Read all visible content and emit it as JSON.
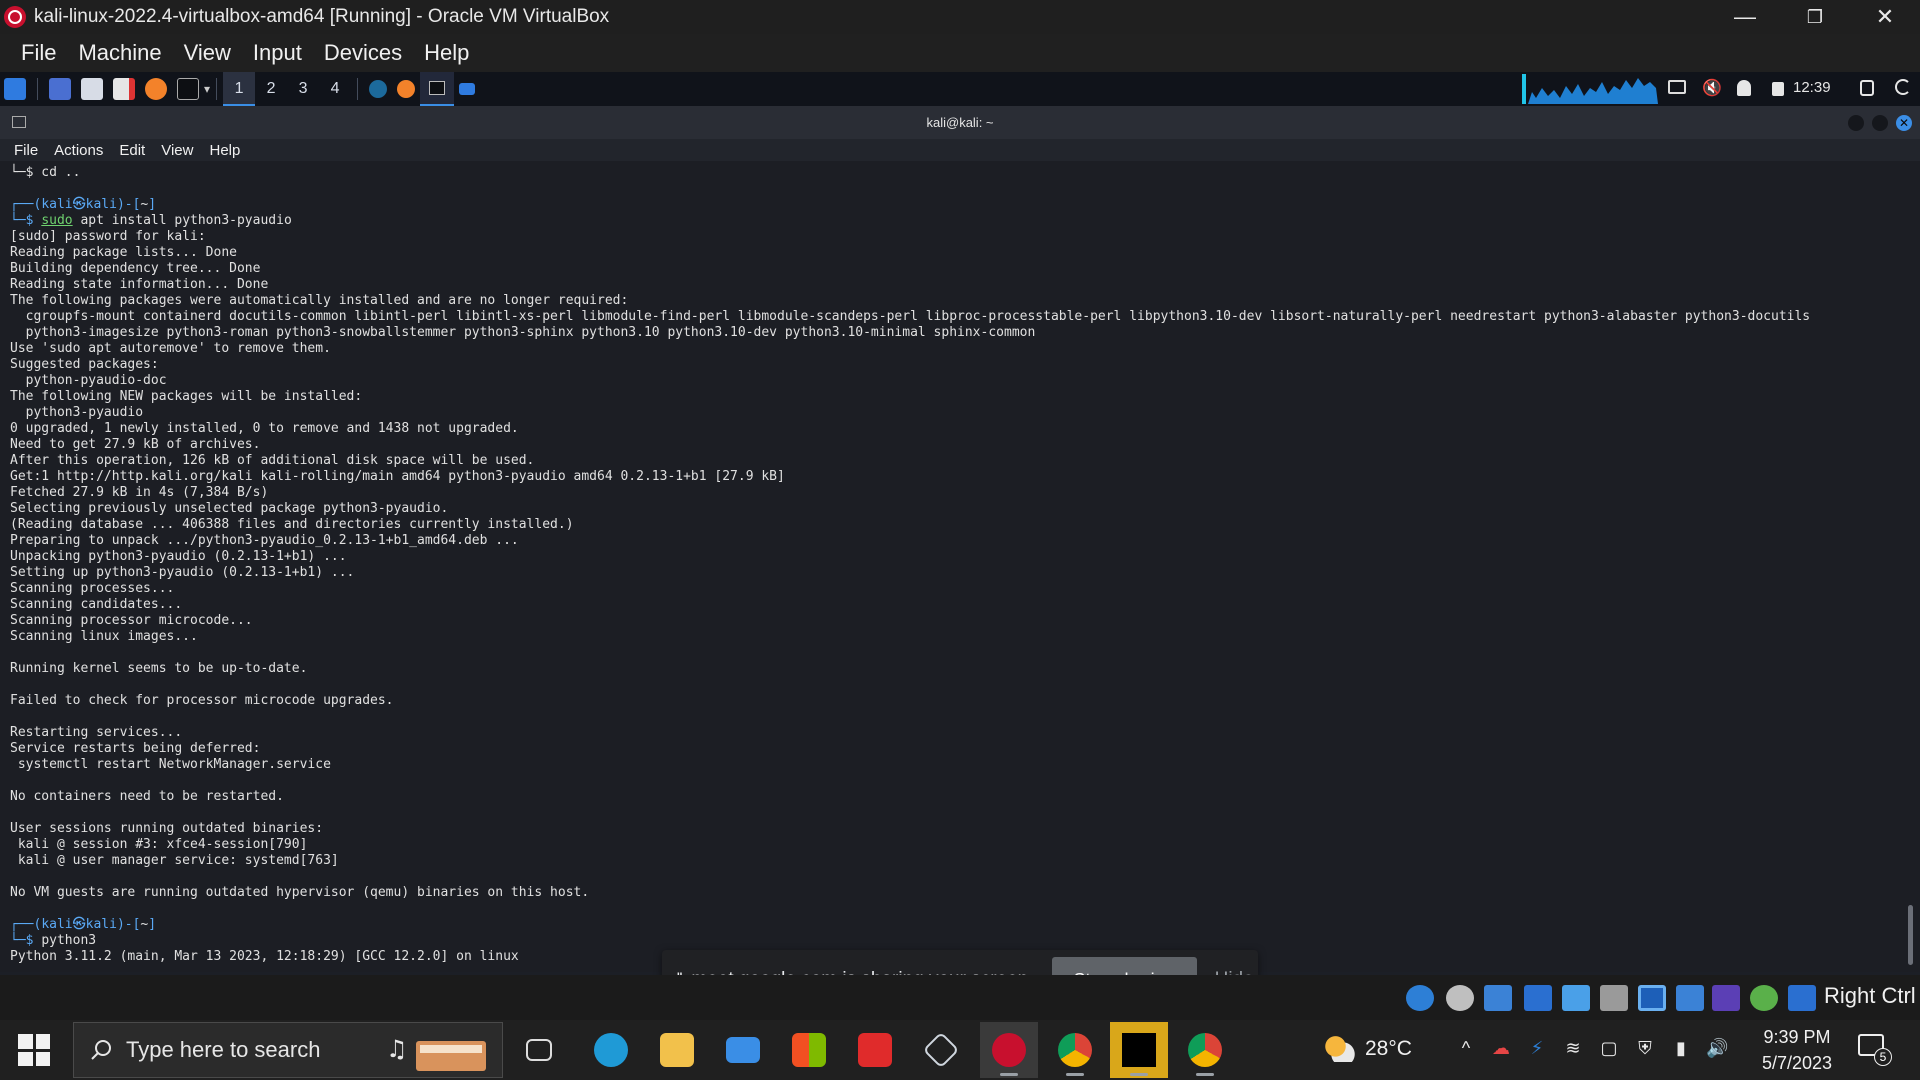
{
  "window": {
    "title": "kali-linux-2022.4-virtualbox-amd64 [Running] - Oracle VM VirtualBox",
    "minimize": "—",
    "restore": "❐",
    "close": "✕"
  },
  "vbox_menu": [
    "File",
    "Machine",
    "View",
    "Input",
    "Devices",
    "Help"
  ],
  "panel": {
    "workspaces": [
      "1",
      "2",
      "3",
      "4"
    ],
    "active_workspace": "1",
    "time": "12:39"
  },
  "terminal": {
    "title": "kali@kali: ~",
    "menu": [
      "File",
      "Actions",
      "Edit",
      "View",
      "Help"
    ],
    "lines": [
      {
        "type": "cmd-cont",
        "text": "└─$ cd .."
      },
      {
        "type": "blank",
        "text": ""
      },
      {
        "type": "prompt",
        "user": "kali",
        "host": "kali",
        "path": "~"
      },
      {
        "type": "cmd",
        "sudo": "sudo",
        "rest": " apt install python3-pyaudio"
      },
      {
        "type": "out",
        "text": "[sudo] password for kali:"
      },
      {
        "type": "out",
        "text": "Reading package lists... Done"
      },
      {
        "type": "out",
        "text": "Building dependency tree... Done"
      },
      {
        "type": "out",
        "text": "Reading state information... Done"
      },
      {
        "type": "out",
        "text": "The following packages were automatically installed and are no longer required:"
      },
      {
        "type": "out",
        "text": "  cgroupfs-mount containerd docutils-common libintl-perl libintl-xs-perl libmodule-find-perl libmodule-scandeps-perl libproc-processtable-perl libpython3.10-dev libsort-naturally-perl needrestart python3-alabaster python3-docutils"
      },
      {
        "type": "out",
        "text": "  python3-imagesize python3-roman python3-snowballstemmer python3-sphinx python3.10 python3.10-dev python3.10-minimal sphinx-common"
      },
      {
        "type": "out",
        "text": "Use 'sudo apt autoremove' to remove them."
      },
      {
        "type": "out",
        "text": "Suggested packages:"
      },
      {
        "type": "out",
        "text": "  python-pyaudio-doc"
      },
      {
        "type": "out",
        "text": "The following NEW packages will be installed:"
      },
      {
        "type": "out",
        "text": "  python3-pyaudio"
      },
      {
        "type": "out",
        "text": "0 upgraded, 1 newly installed, 0 to remove and 1438 not upgraded."
      },
      {
        "type": "out",
        "text": "Need to get 27.9 kB of archives."
      },
      {
        "type": "out",
        "text": "After this operation, 126 kB of additional disk space will be used."
      },
      {
        "type": "out",
        "text": "Get:1 http://http.kali.org/kali kali-rolling/main amd64 python3-pyaudio amd64 0.2.13-1+b1 [27.9 kB]"
      },
      {
        "type": "out",
        "text": "Fetched 27.9 kB in 4s (7,384 B/s)"
      },
      {
        "type": "out",
        "text": "Selecting previously unselected package python3-pyaudio."
      },
      {
        "type": "out",
        "text": "(Reading database ... 406388 files and directories currently installed.)"
      },
      {
        "type": "out",
        "text": "Preparing to unpack .../python3-pyaudio_0.2.13-1+b1_amd64.deb ..."
      },
      {
        "type": "out",
        "text": "Unpacking python3-pyaudio (0.2.13-1+b1) ..."
      },
      {
        "type": "out",
        "text": "Setting up python3-pyaudio (0.2.13-1+b1) ..."
      },
      {
        "type": "out",
        "text": "Scanning processes..."
      },
      {
        "type": "out",
        "text": "Scanning candidates..."
      },
      {
        "type": "out",
        "text": "Scanning processor microcode..."
      },
      {
        "type": "out",
        "text": "Scanning linux images..."
      },
      {
        "type": "blank",
        "text": ""
      },
      {
        "type": "out",
        "text": "Running kernel seems to be up-to-date."
      },
      {
        "type": "blank",
        "text": ""
      },
      {
        "type": "out",
        "text": "Failed to check for processor microcode upgrades."
      },
      {
        "type": "blank",
        "text": ""
      },
      {
        "type": "out",
        "text": "Restarting services..."
      },
      {
        "type": "out",
        "text": "Service restarts being deferred:"
      },
      {
        "type": "out",
        "text": " systemctl restart NetworkManager.service"
      },
      {
        "type": "blank",
        "text": ""
      },
      {
        "type": "out",
        "text": "No containers need to be restarted."
      },
      {
        "type": "blank",
        "text": ""
      },
      {
        "type": "out",
        "text": "User sessions running outdated binaries:"
      },
      {
        "type": "out",
        "text": " kali @ session #3: xfce4-session[790]"
      },
      {
        "type": "out",
        "text": " kali @ user manager service: systemd[763]"
      },
      {
        "type": "blank",
        "text": ""
      },
      {
        "type": "out",
        "text": "No VM guests are running outdated hypervisor (qemu) binaries on this host."
      },
      {
        "type": "blank",
        "text": ""
      },
      {
        "type": "prompt",
        "user": "kali",
        "host": "kali",
        "path": "~"
      },
      {
        "type": "cmd",
        "sudo": "",
        "rest": "python3"
      },
      {
        "type": "out",
        "text": "Python 3.11.2 (main, Mar 13 2023, 12:18:29) [GCC 12.2.0] on linux"
      }
    ]
  },
  "share_bar": {
    "pause": "||",
    "message": "meet.google.com is sharing your screen.",
    "stop": "Stop sharing",
    "hide": "Hide"
  },
  "vbox_status": {
    "host_key": "Right Ctrl"
  },
  "taskbar": {
    "search_placeholder": "Type here to search",
    "weather": "28°C",
    "time": "9:39 PM",
    "date": "5/7/2023",
    "notifications": "5"
  },
  "colors": {
    "kali_blue": "#5aa9f5",
    "accent": "#3a8ee6",
    "virtualbox_red": "#c8102e"
  }
}
